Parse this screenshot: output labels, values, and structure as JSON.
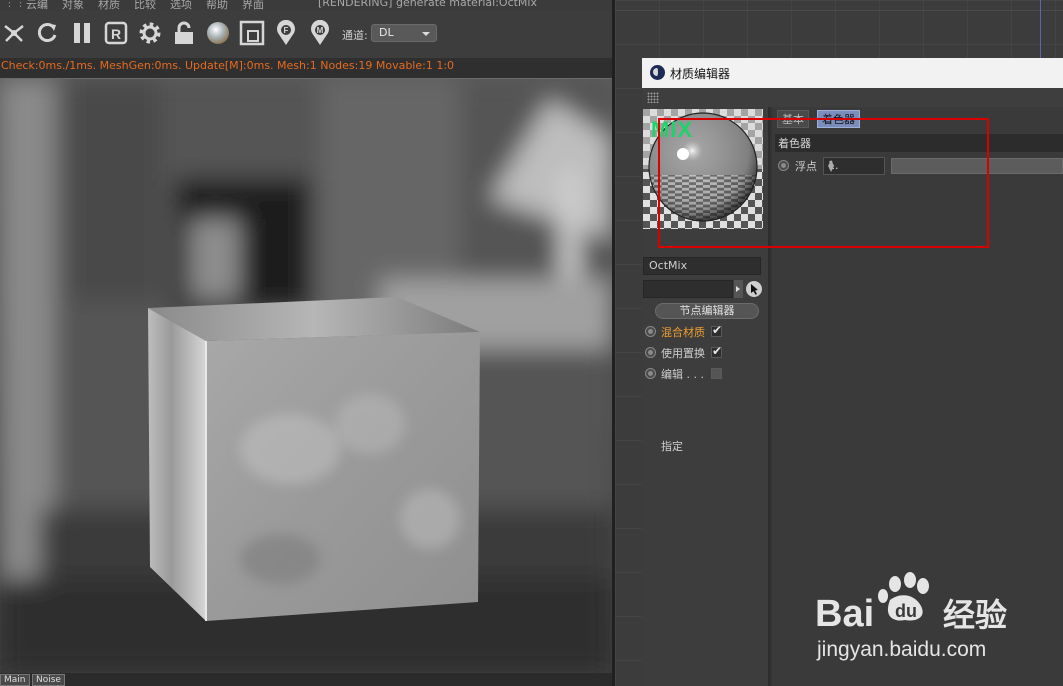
{
  "viewer": {
    "menu": [
      "云编",
      "对象",
      "材质",
      "比较",
      "选项",
      "帮助",
      "界面"
    ],
    "window_title": "[RENDERING] generate material:OctMix",
    "toolbar": {
      "icons": [
        "scissors-icon",
        "refresh-icon",
        "pause-icon",
        "r-icon",
        "gear-icon",
        "lock-icon",
        "sphere-icon",
        "region-icon",
        "focus-pin-icon",
        "material-pin-icon"
      ],
      "channel_label": "通道:",
      "channel_value": "DL"
    },
    "status_text": "Check:0ms./1ms. MeshGen:0ms. Update[M]:0ms. Mesh:1 Nodes:19 Movable:1 1:0",
    "tabs": [
      "Main",
      "Noise"
    ]
  },
  "material_editor": {
    "title": "材质编辑器",
    "preview_label": "MIX",
    "material_name": "OctMix",
    "node_editor_button": "节点编辑器",
    "options": [
      {
        "label": "混合材质",
        "checked": true,
        "highlight": true
      },
      {
        "label": "使用置换",
        "checked": true,
        "highlight": false
      },
      {
        "label": "编辑 . . .",
        "checked": false,
        "highlight": false
      }
    ],
    "assign_label": "指定",
    "tabs": [
      {
        "label": "基本",
        "active": false
      },
      {
        "label": "着色器",
        "active": true
      }
    ],
    "section_title": "着色器",
    "float_label": "浮点",
    "float_value": "1.",
    "colors": {
      "active_tab": "#7a8dbd",
      "mix_green": "#1fd36a",
      "annotation_red": "#d90000",
      "status_orange": "#e56b1f"
    }
  },
  "watermark": {
    "brand": "Bai du 经验",
    "url": "jingyan.baidu.com"
  }
}
